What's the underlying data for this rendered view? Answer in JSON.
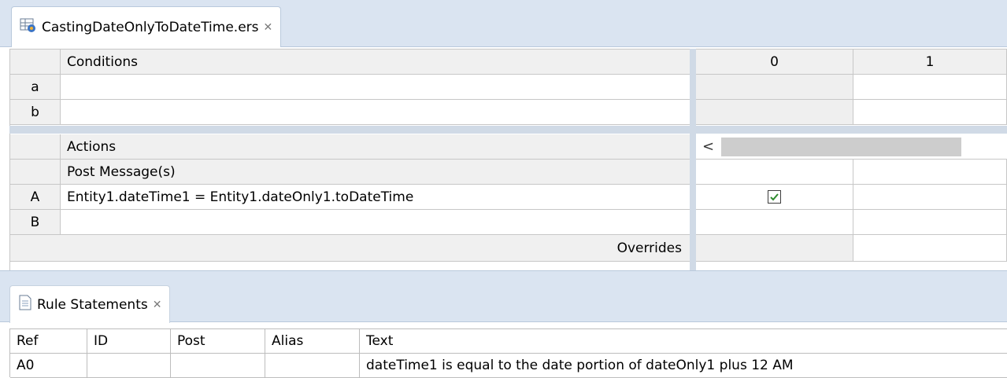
{
  "editor": {
    "tab_title": "CastingDateOnlyToDateTime.ers",
    "tab_icon": "decision-table-icon",
    "conditions": {
      "header": "Conditions",
      "rows": [
        {
          "id": "a",
          "text": ""
        },
        {
          "id": "b",
          "text": ""
        }
      ]
    },
    "actions": {
      "header": "Actions",
      "post_messages": "Post Message(s)",
      "rows": [
        {
          "id": "A",
          "text": "Entity1.dateTime1 = Entity1.dateOnly1.toDateTime"
        },
        {
          "id": "B",
          "text": ""
        }
      ],
      "overrides": "Overrides"
    },
    "columns": [
      "0",
      "1"
    ],
    "action_A_col0_checked": true,
    "scroll_left_glyph": "<"
  },
  "rule_statements": {
    "tab_title": "Rule Statements",
    "tab_icon": "document-icon",
    "columns": [
      "Ref",
      "ID",
      "Post",
      "Alias",
      "Text"
    ],
    "rows": [
      {
        "ref": "A0",
        "id": "",
        "post": "",
        "alias": "",
        "text": "dateTime1 is equal to the date portion of dateOnly1 plus 12 AM"
      }
    ]
  },
  "colors": {
    "tab_strip": "#dae4f1",
    "header_gray": "#f0f0f0",
    "check_green": "#2e8b2e"
  }
}
